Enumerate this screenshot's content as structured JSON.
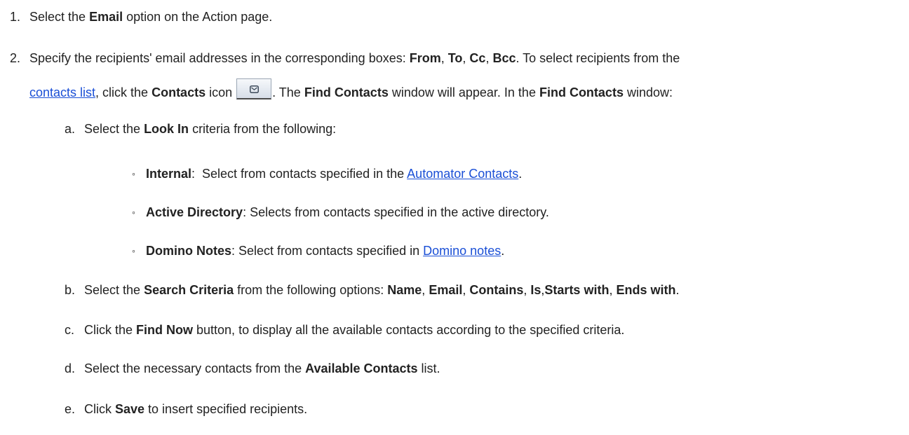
{
  "step1": {
    "marker": "1.",
    "t1": "Select the ",
    "b1": "Email",
    "t2": " option on the Action page."
  },
  "step2": {
    "marker": "2.",
    "line1": {
      "t1": "Specify the recipients' email addresses in the corresponding boxes: ",
      "b_from": "From",
      "sep1": ", ",
      "b_to": "To",
      "sep2": ", ",
      "b_cc": "Cc",
      "sep3": ", ",
      "b_bcc": "Bcc",
      "t2": ". To select recipients from the"
    },
    "line2": {
      "link_contacts_list": "contacts list",
      "t1": ", click the ",
      "b_contacts": "Contacts",
      "t2": " icon ",
      "t3": ". The ",
      "b_find1": "Find Contacts",
      "t4": " window will appear. In the ",
      "b_find2": "Find Contacts",
      "t5": " window:"
    },
    "icon": "mail-envelope-icon"
  },
  "substeps": {
    "a": {
      "marker": "a.",
      "t1": "Select the ",
      "b1": "Look In",
      "t2": " criteria from the following:",
      "bullet_char": "◦",
      "items": [
        {
          "b": "Internal",
          "t1": ":  Select from contacts specified in the ",
          "link": "Automator Contacts",
          "t2": "."
        },
        {
          "b": "Active Directory",
          "t1": ": Selects from contacts specified in the active directory."
        },
        {
          "b": "Domino Notes",
          "t1": ": Select from contacts specified in ",
          "link": "Domino notes",
          "t2": "."
        }
      ]
    },
    "b": {
      "marker": "b.",
      "t1": "Select the ",
      "b1": "Search Criteria",
      "t2": " from the following options: ",
      "o1": "Name",
      "s1": ", ",
      "o2": "Email",
      "s2": ", ",
      "o3": "Contains",
      "s3": ", ",
      "o4": "Is",
      "s4": ",",
      "o5": "Starts with",
      "s5": ", ",
      "o6": "Ends with",
      "end": "."
    },
    "c": {
      "marker": "c.",
      "t1": "Click the ",
      "b1": "Find Now",
      "t2": " button, to display all the available contacts according to the specified criteria."
    },
    "d": {
      "marker": "d.",
      "t1": "Select the necessary contacts from the ",
      "b1": "Available Contacts",
      "t2": " list."
    },
    "e": {
      "marker": "e.",
      "t1": "Click ",
      "b1": "Save",
      "t2": " to insert specified recipients."
    }
  }
}
